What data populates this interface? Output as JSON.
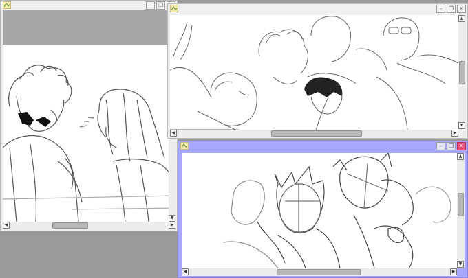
{
  "windows": [
    {
      "id": "left",
      "controls": {
        "minimize": "–",
        "maximize": "❐",
        "close": "✕"
      }
    },
    {
      "id": "top-right",
      "controls": {
        "minimize": "–",
        "maximize": "❐",
        "close": "✕"
      }
    },
    {
      "id": "bottom-right",
      "active": true,
      "controls": {
        "minimize": "–",
        "maximize": "❐",
        "close": "✕"
      }
    }
  ],
  "scroll_arrows": {
    "left": "◀",
    "right": "▶",
    "up": "▲",
    "down": "▼"
  },
  "colors": {
    "desktop": "#9a9a9a",
    "active_title": "#a7a7ff",
    "close_active": "#ea4f7a",
    "sketch_stroke": "#555555"
  }
}
